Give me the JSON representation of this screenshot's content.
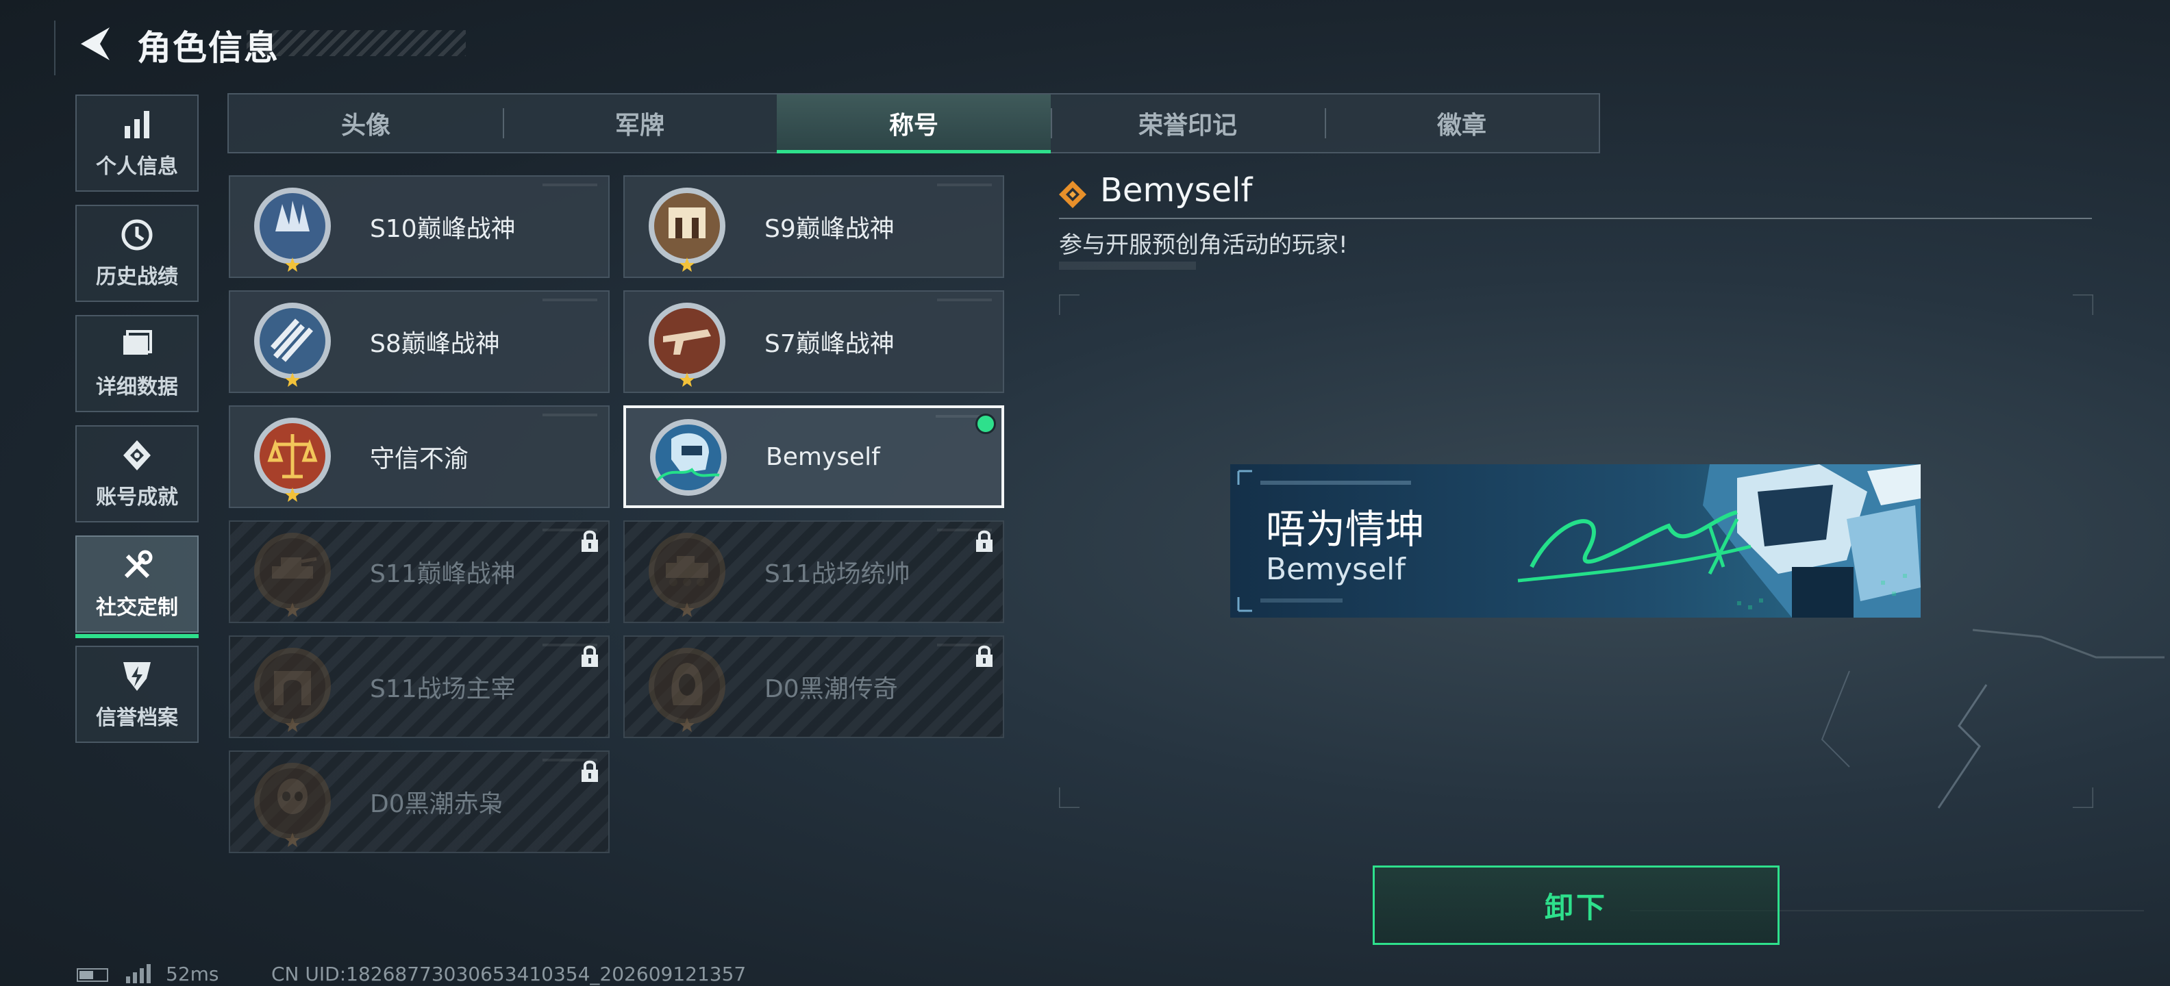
{
  "header": {
    "title": "角色信息"
  },
  "sidebar": {
    "items": [
      {
        "label": "个人信息",
        "icon": "bar-chart-icon"
      },
      {
        "label": "历史战绩",
        "icon": "clock-history-icon"
      },
      {
        "label": "详细数据",
        "icon": "folder-icon"
      },
      {
        "label": "账号成就",
        "icon": "achievement-icon"
      },
      {
        "label": "社交定制",
        "icon": "tools-icon",
        "active": true
      },
      {
        "label": "信誉档案",
        "icon": "shield-lightning-icon"
      }
    ]
  },
  "tabs": [
    {
      "label": "头像"
    },
    {
      "label": "军牌"
    },
    {
      "label": "称号",
      "active": true
    },
    {
      "label": "荣誉印记"
    },
    {
      "label": "徽章"
    }
  ],
  "titles": [
    {
      "name": "S10巅峰战神",
      "state": "unlocked",
      "icon": "castle-medal-icon"
    },
    {
      "name": "S9巅峰战神",
      "state": "unlocked",
      "icon": "gate-medal-icon"
    },
    {
      "name": "S8巅峰战神",
      "state": "unlocked",
      "icon": "stripes-medal-icon"
    },
    {
      "name": "S7巅峰战神",
      "state": "unlocked",
      "icon": "rifle-medal-icon"
    },
    {
      "name": "守信不渝",
      "state": "unlocked",
      "icon": "scales-medal-icon"
    },
    {
      "name": "Bemyself",
      "state": "selected",
      "icon": "helmet-signature-icon"
    },
    {
      "name": "S11巅峰战神",
      "state": "locked",
      "icon": "tank-medal-icon"
    },
    {
      "name": "S11战场统帅",
      "state": "locked",
      "icon": "apc-medal-icon"
    },
    {
      "name": "S11战场主宰",
      "state": "locked",
      "icon": "arch-medal-icon"
    },
    {
      "name": "D0黑潮传奇",
      "state": "locked",
      "icon": "hooded-medal-icon"
    },
    {
      "name": "D0黑潮赤枭",
      "state": "locked",
      "icon": "skull-medal-icon"
    }
  ],
  "detail": {
    "name": "Bemyself",
    "description": "参与开服预创角活动的玩家!",
    "banner_title": "唔为情坤",
    "banner_subtitle": "Bemyself",
    "action_label": "卸下"
  },
  "footer": {
    "ping": "52ms",
    "uid": "CN UID:18268773030653410354_202609121357"
  },
  "colors": {
    "accent": "#2ee08c",
    "bronze": "#8a6a48",
    "locked_text": "#6f7b84"
  }
}
